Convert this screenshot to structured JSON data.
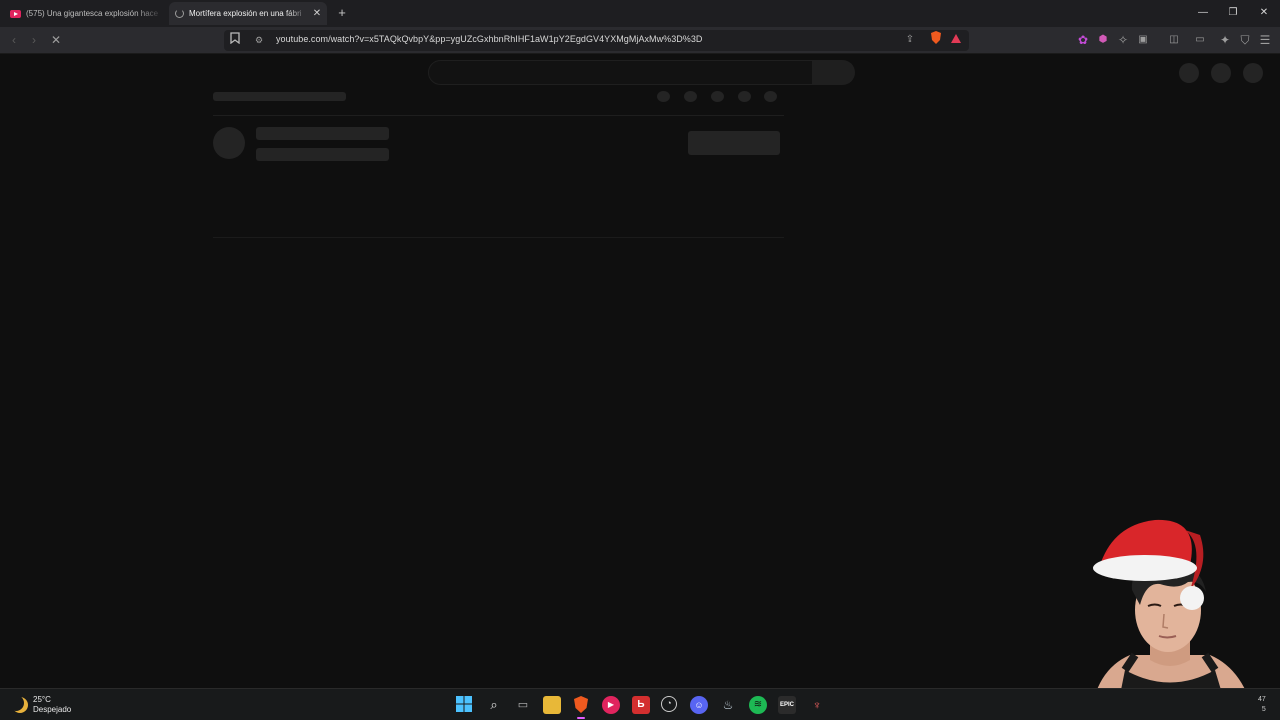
{
  "browser": {
    "tabs": [
      {
        "title": "(575) Una gigantesca explosión hace",
        "favicon": "youtube-icon",
        "active": false
      },
      {
        "title": "Mortífera explosión en una fábri",
        "favicon": "loading-spinner-icon",
        "active": true
      }
    ],
    "url": "youtube.com/watch?v=x5TAQkQvbpY&pp=ygUZcGxhbnRhIHF1aW1pY2EgdGV4YXMgMjAxMw%3D%3D",
    "toolbar_icons": [
      "back-icon",
      "forward-icon",
      "stop-loading-icon",
      "bookmark-icon",
      "site-info-icon",
      "share-icon",
      "brave-shields-icon",
      "brave-rewards-icon",
      "extension-icon",
      "puzzle-icon",
      "sidebar-icon",
      "wallet-icon",
      "leo-icon",
      "vpn-icon",
      "menu-icon"
    ]
  },
  "page": {
    "state": "loading-skeleton"
  },
  "taskbar": {
    "weather": {
      "temp": "25°C",
      "condition": "Despejado"
    },
    "apps": [
      "windows-start-icon",
      "search-icon",
      "task-view-icon",
      "file-explorer-icon",
      "brave-browser-icon",
      "media-player-icon",
      "app-red-icon",
      "clock-app-icon",
      "discord-icon",
      "steam-icon",
      "spotify-icon",
      "epic-games-icon",
      "game-app-icon"
    ],
    "clock_partial": [
      "47",
      "5"
    ]
  },
  "colors": {
    "page_bg": "#0f0f0f",
    "skeleton": "#242424",
    "tab_bar": "#1e1e21",
    "toolbar": "#2b2b2f",
    "accent": "#e35dff"
  }
}
